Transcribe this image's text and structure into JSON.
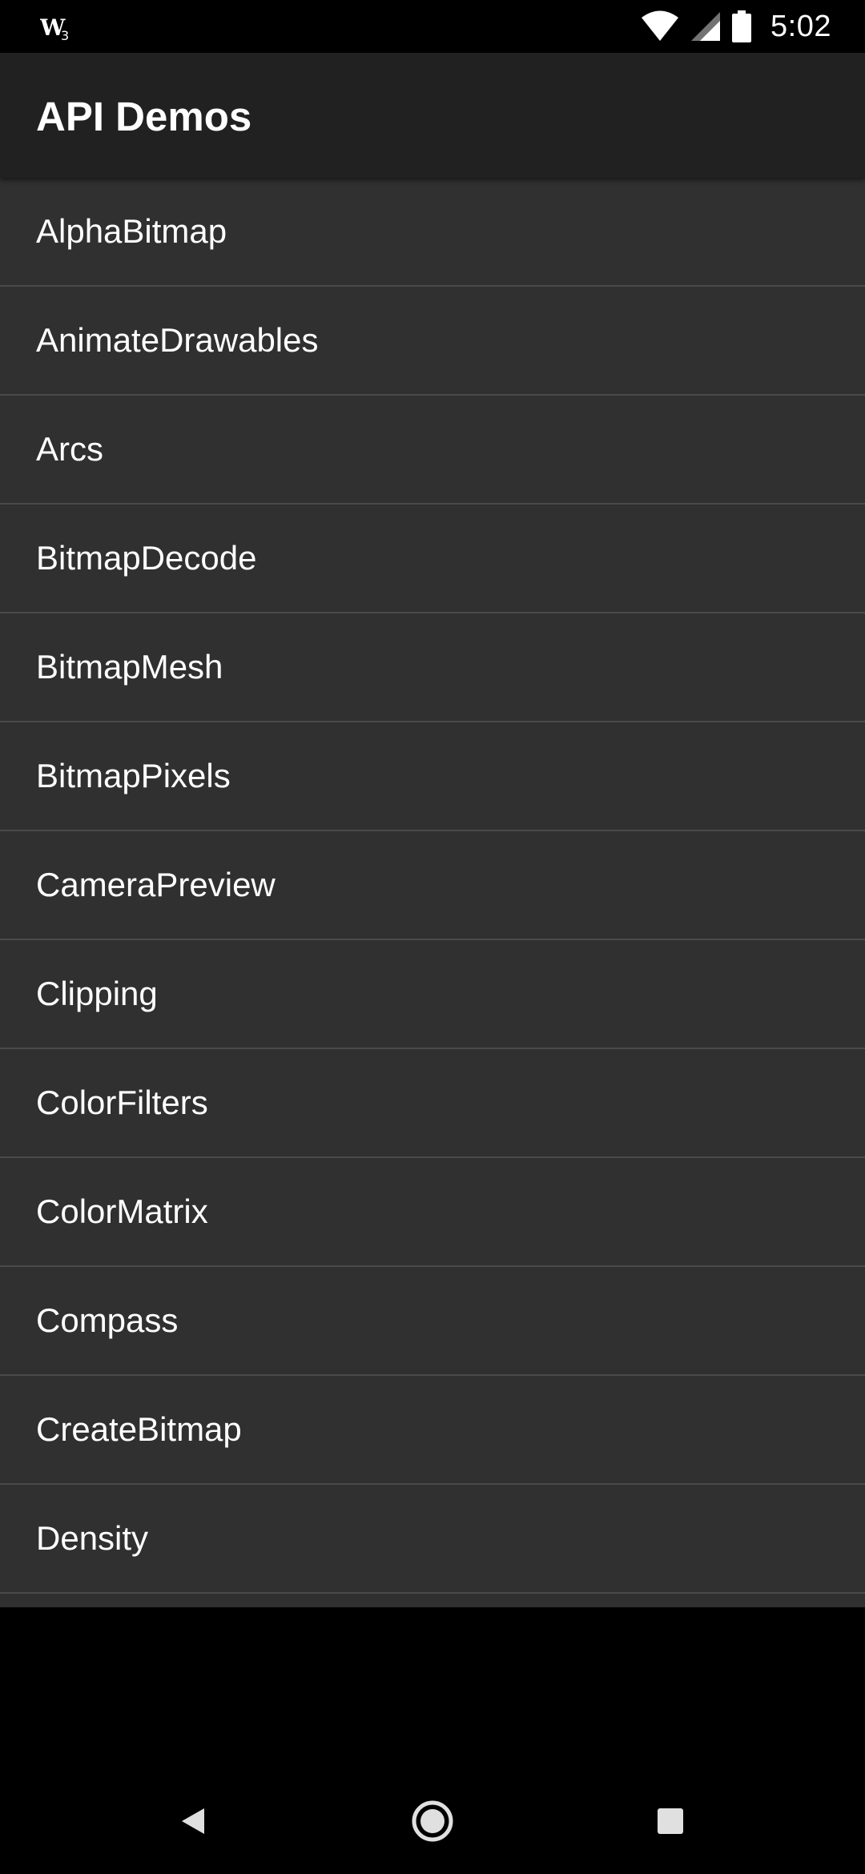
{
  "status_bar": {
    "time": "5:02",
    "left_icon": "wifi-assistant-icon",
    "right_icons": [
      "wifi-icon",
      "signal-icon",
      "battery-icon"
    ]
  },
  "app_bar": {
    "title": "API Demos"
  },
  "list": {
    "items": [
      {
        "label": "AlphaBitmap"
      },
      {
        "label": "AnimateDrawables"
      },
      {
        "label": "Arcs"
      },
      {
        "label": "BitmapDecode"
      },
      {
        "label": "BitmapMesh"
      },
      {
        "label": "BitmapPixels"
      },
      {
        "label": "CameraPreview"
      },
      {
        "label": "Clipping"
      },
      {
        "label": "ColorFilters"
      },
      {
        "label": "ColorMatrix"
      },
      {
        "label": "Compass"
      },
      {
        "label": "CreateBitmap"
      },
      {
        "label": "Density"
      },
      {
        "label": ""
      }
    ]
  },
  "nav_bar": {
    "icons": [
      "back-icon",
      "home-icon",
      "recents-icon"
    ]
  },
  "colors": {
    "app_bar_bg": "#212121",
    "list_bg": "#303030",
    "divider": "#4a4a4a",
    "text": "#ffffff",
    "system_bar_bg": "#000000"
  }
}
